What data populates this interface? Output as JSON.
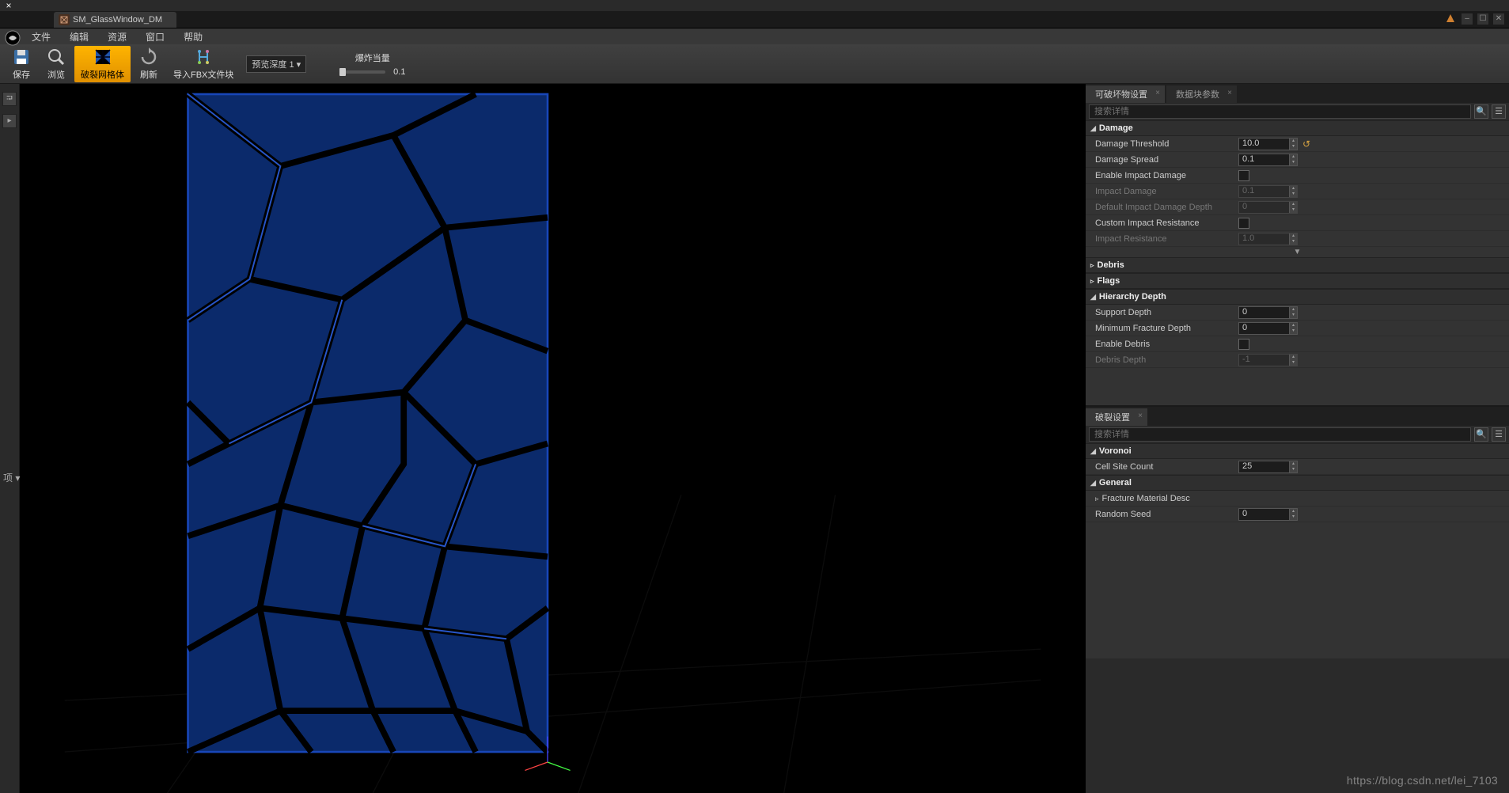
{
  "titlebar": {
    "close": "×"
  },
  "doc_tab": {
    "name": "SM_GlassWindow_DM"
  },
  "menubar": [
    "文件",
    "编辑",
    "资源",
    "窗口",
    "帮助"
  ],
  "toolbar": {
    "save": "保存",
    "browse": "浏览",
    "fracture_mesh": "破裂网格体",
    "refresh": "刷新",
    "import_fbx": "导入FBX文件块",
    "preview_depth_label": "预览深度 1",
    "explode_label": "爆炸当量",
    "explode_value": "0.1"
  },
  "panels": {
    "top_tabs": {
      "destructible_settings": "可破坏物设置",
      "chunk_params": "数据块参数"
    },
    "search_placeholder": "搜索详情",
    "damage": {
      "header": "Damage",
      "threshold_label": "Damage Threshold",
      "threshold_value": "10.0",
      "spread_label": "Damage Spread",
      "spread_value": "0.1",
      "enable_impact_label": "Enable Impact Damage",
      "impact_damage_label": "Impact Damage",
      "impact_damage_value": "0.1",
      "default_depth_label": "Default Impact Damage Depth",
      "default_depth_value": "0",
      "custom_resist_label": "Custom Impact Resistance",
      "impact_resist_label": "Impact Resistance",
      "impact_resist_value": "1.0"
    },
    "debris": {
      "header": "Debris"
    },
    "flags": {
      "header": "Flags"
    },
    "hierarchy": {
      "header": "Hierarchy Depth",
      "support_depth_label": "Support Depth",
      "support_depth_value": "0",
      "min_fracture_label": "Minimum Fracture Depth",
      "min_fracture_value": "0",
      "enable_debris_label": "Enable Debris",
      "debris_depth_label": "Debris Depth",
      "debris_depth_value": "-1"
    },
    "fracture_tab": "破裂设置",
    "voronoi": {
      "header": "Voronoi",
      "cell_count_label": "Cell Site Count",
      "cell_count_value": "25"
    },
    "general": {
      "header": "General",
      "material_desc_label": "Fracture Material Desc",
      "random_seed_label": "Random Seed",
      "random_seed_value": "0"
    }
  },
  "left_label": "项 ▾",
  "watermark": "https://blog.csdn.net/lei_7103"
}
